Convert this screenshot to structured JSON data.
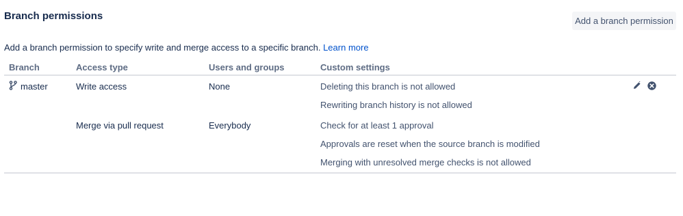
{
  "page": {
    "title": "Branch permissions",
    "add_button_label": "Add a branch permission",
    "description": "Add a branch permission to specify write and merge access to a specific branch.",
    "learn_more": "Learn more"
  },
  "table": {
    "headers": [
      "Branch",
      "Access type",
      "Users and groups",
      "Custom settings"
    ],
    "rows": [
      {
        "branch": "master",
        "branch_icon": "branch-icon",
        "access": [
          {
            "type": "Write access",
            "users": "None",
            "settings": [
              "Deleting this branch is not allowed",
              "Rewriting branch history is not allowed"
            ]
          },
          {
            "type": "Merge via pull request",
            "users": "Everybody",
            "settings": [
              "Check for at least 1 approval",
              "Approvals are reset when the source branch is modified",
              "Merging with unresolved merge checks is not allowed"
            ]
          }
        ],
        "actions": [
          "pencil-icon",
          "remove-icon"
        ]
      }
    ]
  },
  "colors": {
    "link": "#0052cc",
    "text": "#172b4d",
    "header": "#5e6c84",
    "button_bg": "#f4f5f7"
  }
}
